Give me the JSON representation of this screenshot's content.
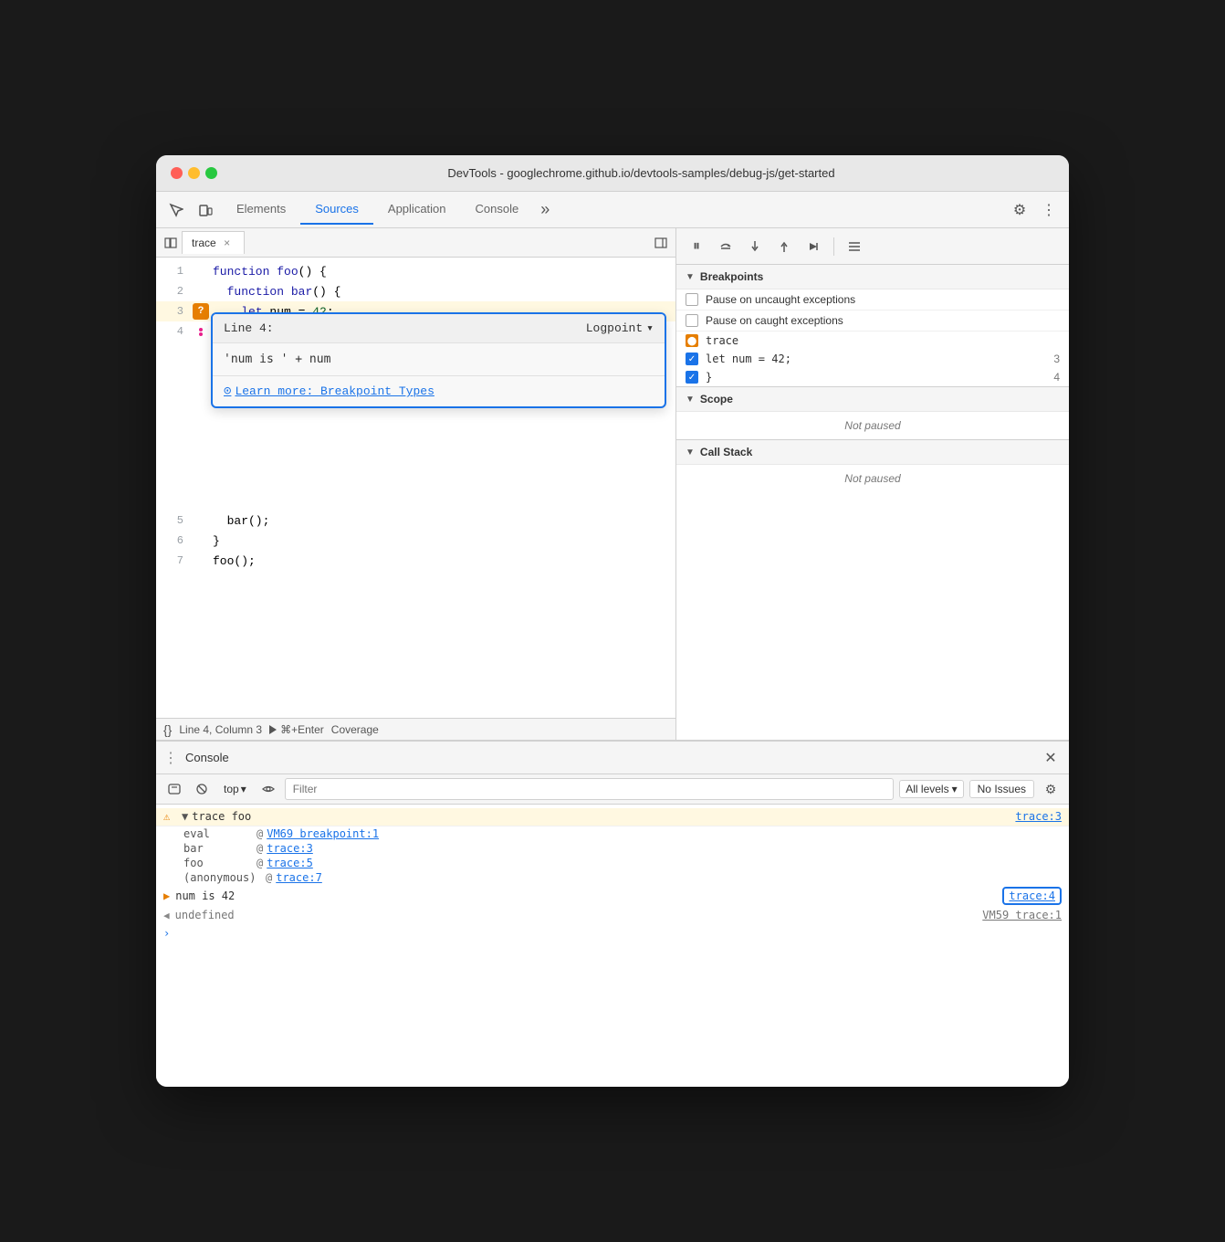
{
  "titleBar": {
    "title": "DevTools - googlechrome.github.io/devtools-samples/debug-js/get-started"
  },
  "topTabs": {
    "items": [
      {
        "label": "Elements",
        "active": false
      },
      {
        "label": "Sources",
        "active": true
      },
      {
        "label": "Application",
        "active": false
      },
      {
        "label": "Console",
        "active": false
      }
    ],
    "moreLabel": "»"
  },
  "sourcePanel": {
    "tabName": "trace",
    "codeLines": [
      {
        "num": "1",
        "content": "function foo() {"
      },
      {
        "num": "2",
        "content": "  function bar() {"
      },
      {
        "num": "3",
        "content": "    let num = 42;"
      },
      {
        "num": "4",
        "content": "  }"
      },
      {
        "num": "5",
        "content": "  bar();"
      },
      {
        "num": "6",
        "content": "}"
      },
      {
        "num": "7",
        "content": "foo();"
      }
    ],
    "statusBar": {
      "linecol": "Line 4, Column 3",
      "runLabel": "⌘+Enter",
      "coverageLabel": "Coverage"
    }
  },
  "logpointPopup": {
    "lineLabel": "Line 4:",
    "typeLabel": "Logpoint",
    "inputValue": "'num is ' + num",
    "linkLabel": "Learn more: Breakpoint Types"
  },
  "debugPanel": {
    "breakpoints": {
      "sectionTitle": "Breakpoints",
      "option1": "Pause on uncaught exceptions",
      "option2": "Pause on caught exceptions",
      "items": [
        {
          "name": "trace",
          "type": "orange-icon"
        },
        {
          "name": "let num = 42;",
          "checked": true,
          "line": "3"
        },
        {
          "name": "}",
          "checked": true,
          "line": "4"
        }
      ]
    },
    "scope": {
      "sectionTitle": "Scope",
      "notPaused": "Not paused"
    },
    "callStack": {
      "sectionTitle": "Call Stack",
      "notPaused": "Not paused"
    }
  },
  "console": {
    "title": "Console",
    "toolbar": {
      "topLabel": "top",
      "filterPlaceholder": "Filter",
      "allLevelsLabel": "All levels",
      "noIssuesLabel": "No Issues"
    },
    "entries": [
      {
        "type": "trace",
        "icon": "▶",
        "label": "▼ trace foo",
        "link": "trace:3"
      }
    ],
    "traceRows": [
      {
        "label": "eval",
        "at": "@",
        "link": "VM69 breakpoint:1"
      },
      {
        "label": "bar",
        "at": "@",
        "link": "trace:3"
      },
      {
        "label": "foo",
        "at": "@",
        "link": "trace:5"
      },
      {
        "label": "(anonymous)",
        "at": "@",
        "link": "trace:7"
      }
    ],
    "numIs42": {
      "value": "num is 42",
      "link": "trace:4"
    },
    "undefinedRow": {
      "value": "undefined",
      "link": "VM59 trace:1"
    }
  }
}
